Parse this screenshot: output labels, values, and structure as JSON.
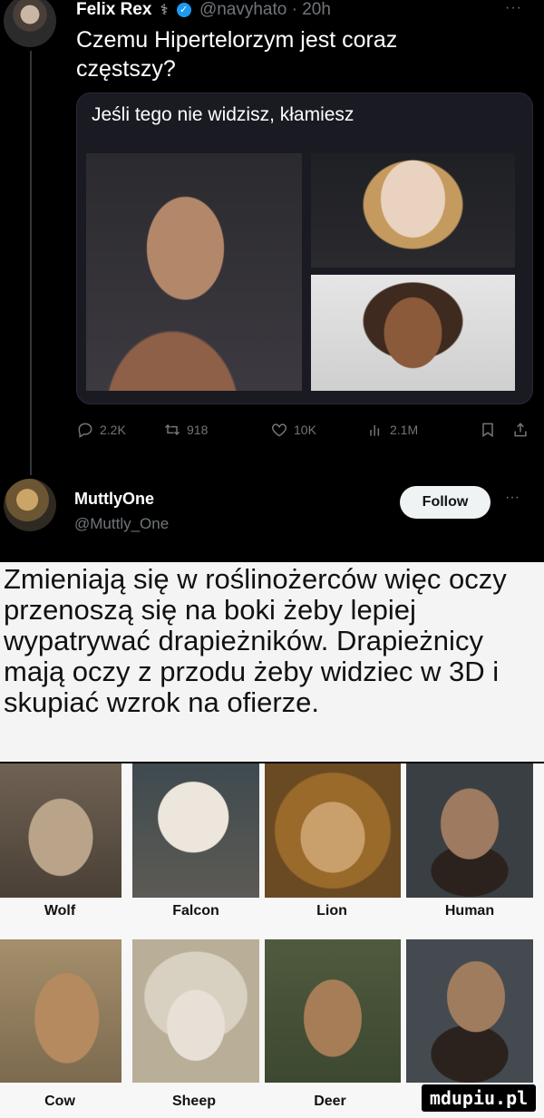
{
  "tweet": {
    "author_name": "Felix Rex",
    "author_handle": "@navyhato",
    "time": "20h",
    "badge_glyph": "⚕",
    "text": "Czemu Hipertelorzym jest coraz częstszy?",
    "quote_text": "Jeśli tego nie widzisz, kłamiesz",
    "more": "···",
    "stats": {
      "replies": "2.2K",
      "retweets": "918",
      "likes": "10K",
      "views": "2.1M"
    },
    "icons": [
      "reply-icon",
      "retweet-icon",
      "like-icon",
      "views-icon",
      "bookmark-icon",
      "share-icon"
    ]
  },
  "reply": {
    "author_name": "MuttlyOne",
    "author_handle": "@Muttly_One",
    "follow_label": "Follow",
    "more": "···"
  },
  "caption": "Zmieniają się w roślinożerców więc oczy przenoszą się na boki żeby lepiej wypatrywać drapieżników. Drapieżnicy mają oczy z przodu żeby widziec w 3D i skupiać wzrok na ofierze.",
  "grid": {
    "labels": [
      "Wolf",
      "Falcon",
      "Lion",
      "Human",
      "Cow",
      "Sheep",
      "Deer"
    ]
  },
  "watermark": "mdupiu.pl",
  "colors": {
    "background": "#000000",
    "accent": "#1d9bf0",
    "muted": "#71767b",
    "caption_bg": "#f4f4f4"
  }
}
